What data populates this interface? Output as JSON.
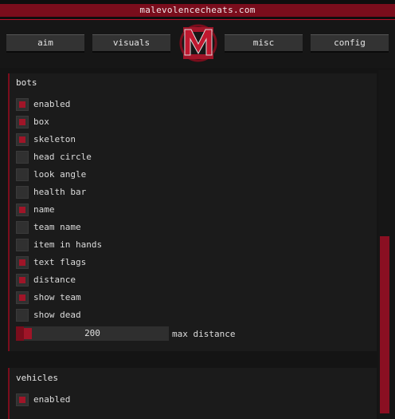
{
  "window": {
    "title": "malevolencecheats.com"
  },
  "tabs": [
    {
      "label": "aim"
    },
    {
      "label": "visuals"
    },
    {
      "label": "misc"
    },
    {
      "label": "config"
    }
  ],
  "logo": {
    "letter": "M"
  },
  "colors": {
    "accent": "#7a0d1c",
    "accent_bright": "#a01528",
    "background": "#141414",
    "panel": "#1b1b1b"
  },
  "bots": {
    "title": "bots",
    "options": [
      {
        "label": "enabled",
        "checked": true
      },
      {
        "label": "box",
        "checked": true
      },
      {
        "label": "skeleton",
        "checked": true
      },
      {
        "label": "head circle",
        "checked": false
      },
      {
        "label": "look angle",
        "checked": false
      },
      {
        "label": "health bar",
        "checked": false
      },
      {
        "label": "name",
        "checked": true
      },
      {
        "label": "team name",
        "checked": false
      },
      {
        "label": "item in hands",
        "checked": false
      },
      {
        "label": "text flags",
        "checked": true
      },
      {
        "label": "distance",
        "checked": true
      },
      {
        "label": "show team",
        "checked": true
      },
      {
        "label": "show dead",
        "checked": false
      }
    ],
    "max_distance": {
      "value": "200",
      "label": "max distance",
      "fraction": 0.05
    }
  },
  "vehicles": {
    "title": "vehicles",
    "options": [
      {
        "label": "enabled",
        "checked": true
      }
    ]
  }
}
